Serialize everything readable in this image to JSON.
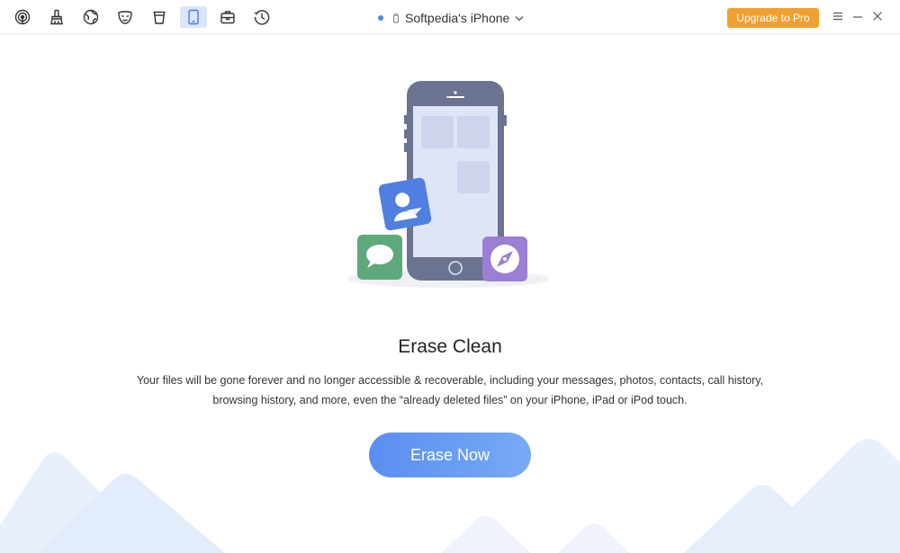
{
  "toolbar": {
    "tools": [
      {
        "icon": "airdrop-icon"
      },
      {
        "icon": "brush-icon"
      },
      {
        "icon": "globe-icon"
      },
      {
        "icon": "mask-icon"
      },
      {
        "icon": "trash-bin-icon"
      },
      {
        "icon": "phone-icon",
        "active": true
      },
      {
        "icon": "toolbox-icon"
      },
      {
        "icon": "history-icon"
      }
    ],
    "device_name": "Softpedia's iPhone",
    "upgrade_label": "Upgrade to Pro"
  },
  "main": {
    "title": "Erase Clean",
    "description": "Your files will be gone forever and no longer accessible & recoverable, including your messages, photos, contacts, call history, browsing history, and more, even the “already deleted files” on your iPhone, iPad or iPod touch.",
    "erase_button": "Erase Now"
  },
  "colors": {
    "accent": "#5a8ef0",
    "upgrade": "#f0a030",
    "active_tool_bg": "#d9e6fb",
    "phone_body": "#6b7391",
    "messages_icon": "#5ea97c",
    "safari_icon": "#9b7fd4",
    "contacts_icon": "#4f7fe0"
  }
}
